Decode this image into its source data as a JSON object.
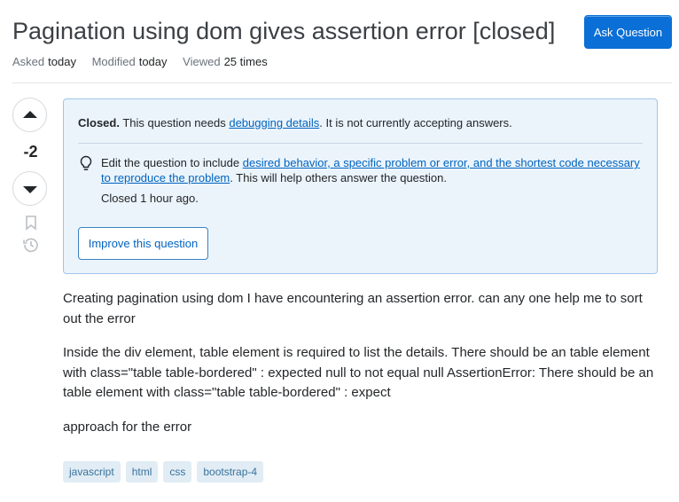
{
  "question": {
    "title": "Pagination using dom gives assertion error [closed]",
    "ask_button": "Ask Question",
    "meta": {
      "asked_label": "Asked",
      "asked_value": "today",
      "modified_label": "Modified",
      "modified_value": "today",
      "viewed_label": "Viewed",
      "viewed_value": "25 times"
    }
  },
  "vote": {
    "count": "-2"
  },
  "notice": {
    "closed_label": "Closed.",
    "line1_pre": "This question needs",
    "line1_link": "debugging details",
    "line1_post": ". It is not currently accepting answers.",
    "edit_pre": "Edit the question to include",
    "edit_link": "desired behavior, a specific problem or error, and the shortest code necessary to reproduce the problem",
    "edit_post": ". This will help others answer the question.",
    "closed_ago": "Closed 1 hour ago.",
    "improve_button": "Improve this question"
  },
  "body": {
    "paragraphs": [
      "Creating pagination using dom I have encountering an assertion error. can any one help me to sort out the error",
      "Inside the div element, table element is required to list the details. There should be an table element with class=\"table table-bordered\" : expected null to not equal null AssertionError: There should be an table element with class=\"table table-bordered\" : expect",
      "approach for the error"
    ]
  },
  "tags": [
    "javascript",
    "html",
    "css",
    "bootstrap-4"
  ],
  "colors": {
    "accent": "#0a6fd6",
    "notice_bg": "#ebf4fb",
    "tag_bg": "#e1ecf4",
    "tag_text": "#39739d"
  },
  "icons": [
    "arrow-up-icon",
    "arrow-down-icon",
    "bookmark-icon",
    "history-icon",
    "lightbulb-icon"
  ]
}
